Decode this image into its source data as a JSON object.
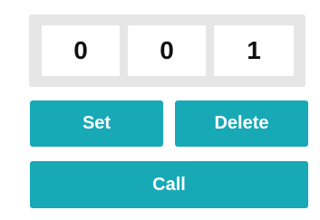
{
  "digits": [
    "0",
    "0",
    "1"
  ],
  "buttons": {
    "set": "Set",
    "delete": "Delete",
    "call": "Call"
  },
  "colors": {
    "button_bg": "#17a9b6",
    "panel_bg": "#e6e6e6",
    "digit_bg": "#ffffff"
  }
}
